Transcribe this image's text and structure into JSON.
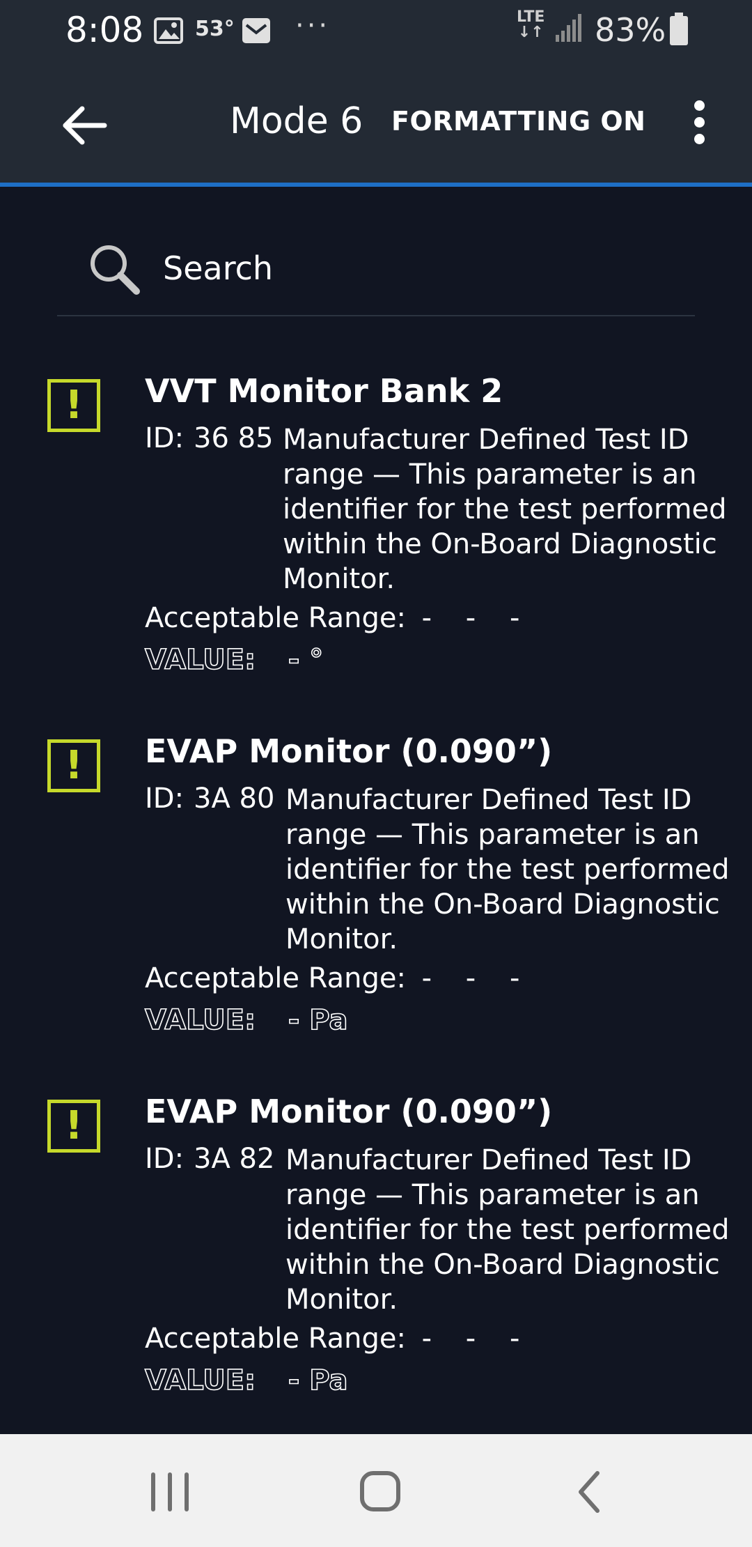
{
  "status_bar": {
    "time": "8:08",
    "temperature": "53°",
    "more": "···",
    "network": "LTE",
    "battery": "83%"
  },
  "toolbar": {
    "title": "Mode 6",
    "format_label": "FORMATTING ON"
  },
  "search": {
    "placeholder": "Search"
  },
  "colors": {
    "background": "#111522",
    "toolbar": "#232a34",
    "accent": "#1e6fc6",
    "warning": "#c6d92b",
    "navbar": "#f1f1f1"
  },
  "items": [
    {
      "icon": "warning-icon",
      "title": "VVT Monitor Bank 2",
      "id_label": "ID:",
      "id": "36 85",
      "description": "Manufacturer Defined Test ID range — This parameter is an identifier for the test performed within the On-Board Diagnostic Monitor.",
      "range_label": "Acceptable Range:",
      "range": "- - -",
      "value_label": "VALUE:",
      "value": "- °"
    },
    {
      "icon": "warning-icon",
      "title": "EVAP Monitor (0.090”)",
      "id_label": "ID:",
      "id": "3A 80",
      "description": "Manufacturer Defined Test ID range — This parameter is an identifier for the test performed within the On-Board Diagnostic Monitor.",
      "range_label": "Acceptable Range:",
      "range": "- - -",
      "value_label": "VALUE:",
      "value": "- Pa"
    },
    {
      "icon": "warning-icon",
      "title": "EVAP Monitor (0.090”)",
      "id_label": "ID:",
      "id": "3A 82",
      "description": "Manufacturer Defined Test ID range — This parameter is an identifier for the test performed within the On-Board Diagnostic Monitor.",
      "range_label": "Acceptable Range:",
      "range": "- - -",
      "value_label": "VALUE:",
      "value": "- Pa"
    }
  ],
  "nav_bar": {
    "recents": "recents-icon",
    "home": "home-icon",
    "back": "back-icon"
  }
}
